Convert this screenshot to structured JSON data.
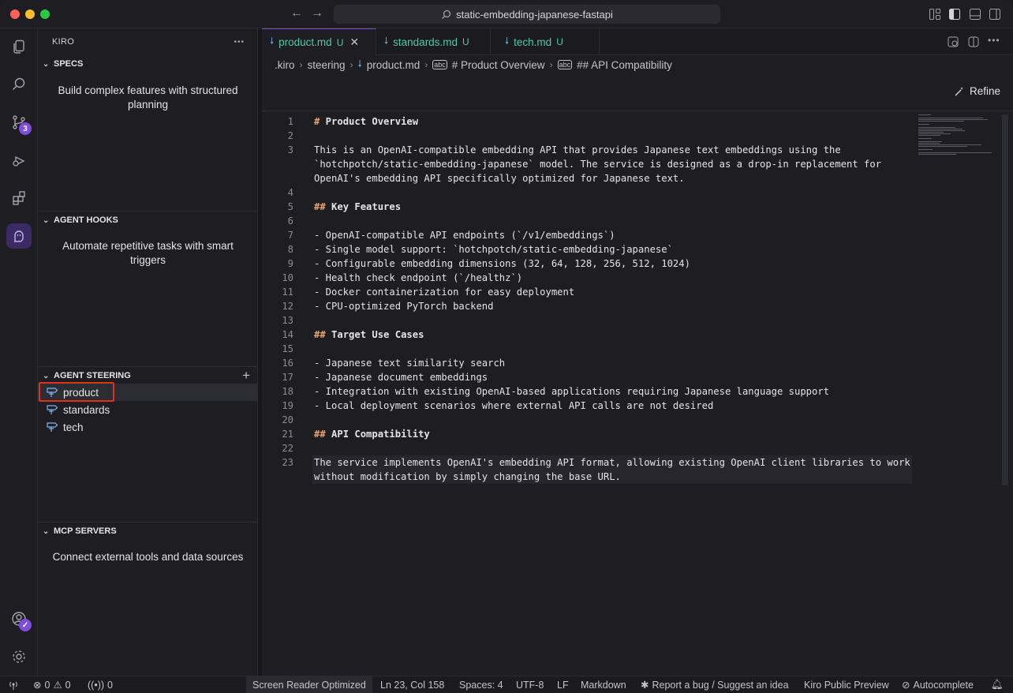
{
  "titlebar": {
    "search_text": "static-embedding-japanese-fastapi"
  },
  "activity": {
    "scm_badge": "3"
  },
  "sidebar": {
    "title": "KIRO",
    "more": "•••",
    "specs": {
      "title": "SPECS",
      "desc": "Build complex features with structured planning"
    },
    "hooks": {
      "title": "AGENT HOOKS",
      "desc": "Automate repetitive tasks with smart triggers"
    },
    "steering": {
      "title": "AGENT STEERING",
      "add": "+",
      "items": [
        {
          "label": "product"
        },
        {
          "label": "standards"
        },
        {
          "label": "tech"
        }
      ]
    },
    "mcp": {
      "title": "MCP SERVERS",
      "desc": "Connect external tools and data sources"
    }
  },
  "tabs": [
    {
      "label": "product.md",
      "status": "U"
    },
    {
      "label": "standards.md",
      "status": "U"
    },
    {
      "label": "tech.md",
      "status": "U"
    }
  ],
  "breadcrumb": [
    ".kiro",
    "steering",
    "product.md",
    "# Product Overview",
    "## API Compatibility"
  ],
  "refine_label": "Refine",
  "code_lines": [
    {
      "n": "1",
      "t": "# Product Overview",
      "h": true
    },
    {
      "n": "2",
      "t": ""
    },
    {
      "n": "3",
      "t": "This is an OpenAI-compatible embedding API that provides Japanese text embeddings using the"
    },
    {
      "n": "",
      "t": "`hotchpotch/static-embedding-japanese` model. The service is designed as a drop-in replacement for"
    },
    {
      "n": "",
      "t": "OpenAI's embedding API specifically optimized for Japanese text."
    },
    {
      "n": "4",
      "t": ""
    },
    {
      "n": "5",
      "t": "## Key Features",
      "h": true
    },
    {
      "n": "6",
      "t": ""
    },
    {
      "n": "7",
      "t": "- OpenAI-compatible API endpoints (`/v1/embeddings`)"
    },
    {
      "n": "8",
      "t": "- Single model support: `hotchpotch/static-embedding-japanese`"
    },
    {
      "n": "9",
      "t": "- Configurable embedding dimensions (32, 64, 128, 256, 512, 1024)"
    },
    {
      "n": "10",
      "t": "- Health check endpoint (`/healthz`)"
    },
    {
      "n": "11",
      "t": "- Docker containerization for easy deployment"
    },
    {
      "n": "12",
      "t": "- CPU-optimized PyTorch backend"
    },
    {
      "n": "13",
      "t": ""
    },
    {
      "n": "14",
      "t": "## Target Use Cases",
      "h": true
    },
    {
      "n": "15",
      "t": ""
    },
    {
      "n": "16",
      "t": "- Japanese text similarity search"
    },
    {
      "n": "17",
      "t": "- Japanese document embeddings"
    },
    {
      "n": "18",
      "t": "- Integration with existing OpenAI-based applications requiring Japanese language support"
    },
    {
      "n": "19",
      "t": "- Local deployment scenarios where external API calls are not desired"
    },
    {
      "n": "20",
      "t": ""
    },
    {
      "n": "21",
      "t": "## API Compatibility",
      "h": true
    },
    {
      "n": "22",
      "t": ""
    },
    {
      "n": "23",
      "t": "The service implements OpenAI's embedding API format, allowing existing OpenAI client libraries to work"
    },
    {
      "n": "",
      "t": "without modification by simply changing the base URL."
    }
  ],
  "status": {
    "errors": "0",
    "warnings": "0",
    "ports": "0",
    "screen_reader": "Screen Reader Optimized",
    "position": "Ln 23, Col 158",
    "spaces": "Spaces: 4",
    "encoding": "UTF-8",
    "eol": "LF",
    "language": "Markdown",
    "report": "Report a bug / Suggest an idea",
    "preview": "Kiro Public Preview",
    "autocomplete": "Autocomplete"
  },
  "colors": {
    "accent": "#7c4dde",
    "untracked": "#4ec9a0",
    "highlight_box": "#e0301e"
  }
}
